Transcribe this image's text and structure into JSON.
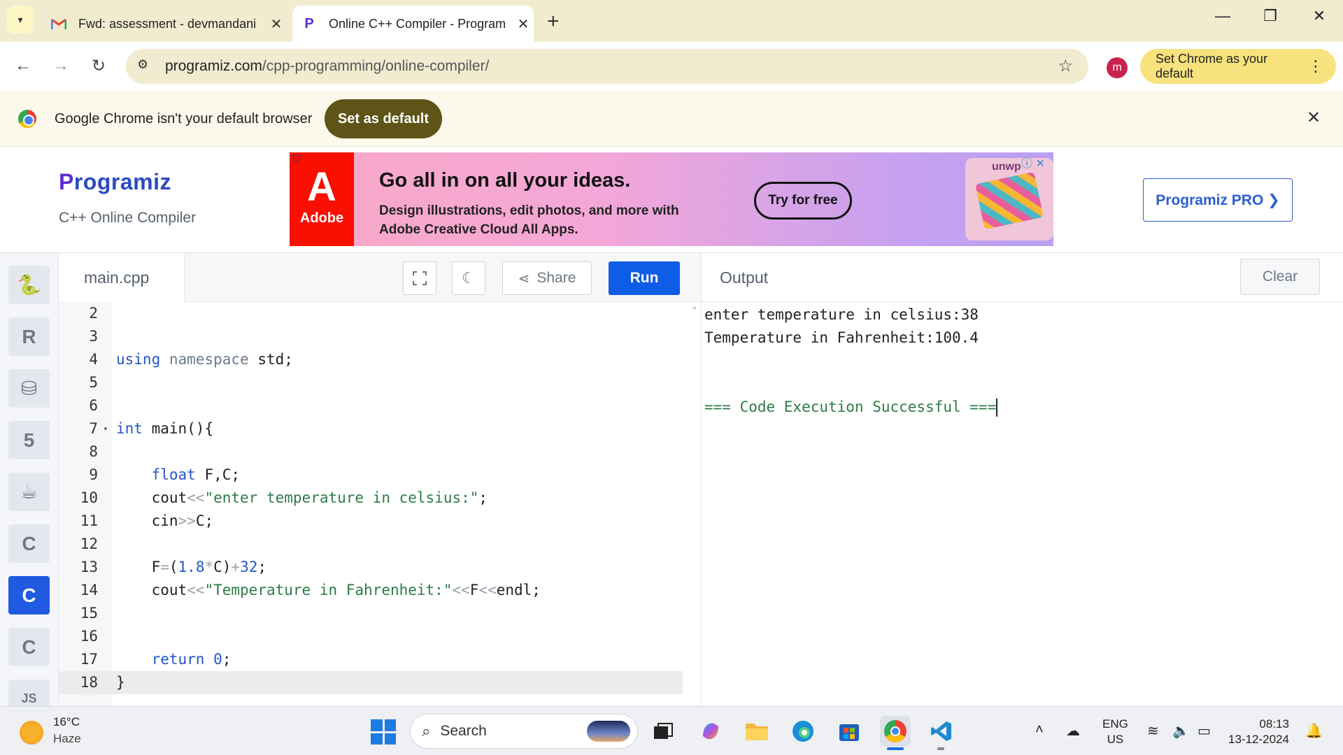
{
  "browser": {
    "tabs": [
      {
        "title": "Fwd: assessment - devmandani",
        "favicon": "gmail-icon"
      },
      {
        "title": "Online C++ Compiler - Program",
        "favicon": "programiz-icon"
      }
    ],
    "url_domain": "programiz.com",
    "url_path": "/cpp-programming/online-compiler/",
    "profile_initial": "m",
    "set_chrome_default_label": "Set Chrome as your default"
  },
  "infobar": {
    "message": "Google Chrome isn't your default browser",
    "button_label": "Set as default"
  },
  "site": {
    "logo_text": "rogramiz",
    "logo_initial": "P",
    "subtitle": "C++ Online Compiler",
    "pro_button": "Programiz PRO ❯"
  },
  "ad": {
    "brand": "Adobe",
    "headline": "Go all in on all your ideas.",
    "body": "Design illustrations, edit photos, and more with Adobe Creative Cloud All Apps.",
    "cta": "Try for free",
    "product": "unwp"
  },
  "editor": {
    "filename": "main.cpp",
    "share_label": "Share",
    "run_label": "Run",
    "lines": [
      {
        "n": "2",
        "code": ""
      },
      {
        "n": "3",
        "code": ""
      },
      {
        "n": "4",
        "code": "using namespace std;"
      },
      {
        "n": "5",
        "code": ""
      },
      {
        "n": "6",
        "code": ""
      },
      {
        "n": "7",
        "code": "int main(){"
      },
      {
        "n": "8",
        "code": ""
      },
      {
        "n": "9",
        "code": "    float F,C;"
      },
      {
        "n": "10",
        "code": "    cout<<\"enter temperature in celsius:\";"
      },
      {
        "n": "11",
        "code": "    cin>>C;"
      },
      {
        "n": "12",
        "code": ""
      },
      {
        "n": "13",
        "code": "    F=(1.8*C)+32;"
      },
      {
        "n": "14",
        "code": "    cout<<\"Temperature in Fahrenheit:\"<<F<<endl;"
      },
      {
        "n": "15",
        "code": ""
      },
      {
        "n": "16",
        "code": ""
      },
      {
        "n": "17",
        "code": "    return 0;"
      },
      {
        "n": "18",
        "code": "}"
      }
    ]
  },
  "output": {
    "title": "Output",
    "clear_label": "Clear",
    "lines": [
      "enter temperature in celsius:38",
      "Temperature in Fahrenheit:100.4",
      "",
      "",
      "=== Code Execution Successful ==="
    ]
  },
  "sidebar": {
    "languages": [
      {
        "name": "python-icon",
        "glyph": "🐍"
      },
      {
        "name": "r-icon",
        "glyph": "R"
      },
      {
        "name": "sql-icon",
        "glyph": "⛁"
      },
      {
        "name": "html5-icon",
        "glyph": "5"
      },
      {
        "name": "java-icon",
        "glyph": "☕"
      },
      {
        "name": "c-icon",
        "glyph": "C"
      },
      {
        "name": "cpp-icon",
        "glyph": "C"
      },
      {
        "name": "csharp-icon",
        "glyph": "C"
      },
      {
        "name": "js-icon",
        "glyph": "JS"
      }
    ],
    "active_index": 6
  },
  "taskbar": {
    "weather_temp": "16°C",
    "weather_desc": "Haze",
    "search_placeholder": "Search",
    "lang_line1": "ENG",
    "lang_line2": "US",
    "time": "08:13",
    "date": "13-12-2024"
  }
}
